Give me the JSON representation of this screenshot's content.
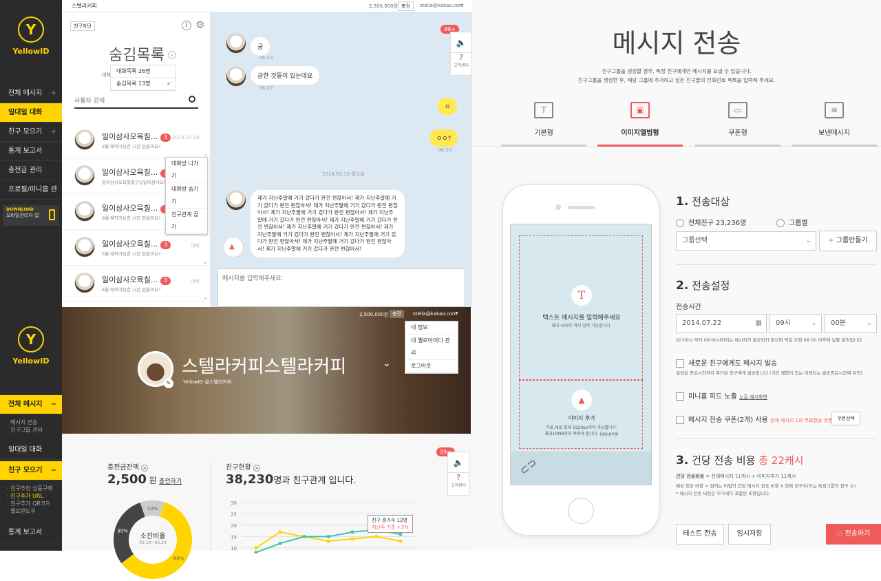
{
  "brand": {
    "logo_letter": "Y",
    "name": "YellowID"
  },
  "sidebar_top": {
    "items": [
      {
        "label": "전체 메시지",
        "plus": "+"
      },
      {
        "label": "일대일 대화"
      },
      {
        "label": "친구 모으기",
        "plus": "+"
      },
      {
        "label": "통계 보고서"
      },
      {
        "label": "충전금 관리"
      },
      {
        "label": "프로필/미니홈 관리"
      }
    ],
    "download_line1": "DOWNLOAD",
    "download_line2": "모바일관리자 앱"
  },
  "topbar": {
    "title": "스텔라커피",
    "balance": "2,500,000원",
    "charge": "충전",
    "email": "stella@kakao.com"
  },
  "hidden_list": {
    "block_label": "친구차단",
    "info_icon": "i",
    "title": "숨김목록",
    "dropdown": [
      "대화목록 26명",
      "숨김목록 13명"
    ],
    "dropdown_check": "✓",
    "truncated_line": "대화",
    "search_placeholder": "사용자 검색"
  },
  "chat_items": [
    {
      "name": "일이삼사오육칠...",
      "badge": "3",
      "preview": "6월 예약가능한 시간 있을까요?",
      "time": "2014.07.09"
    },
    {
      "name": "일이삼사오육칠...",
      "badge": "3",
      "preview": "일이삼사오육칠팔구십일이삼사오육칠"
    },
    {
      "name": "일이삼사오육칠...",
      "badge": "3",
      "preview": "6월 예약가능한 시간 있을까요?",
      "time": "어제"
    },
    {
      "name": "일이삼사오육칠...",
      "badge": "3",
      "preview": "6월 예약가능한 시간 있을까요?",
      "time": "어제"
    },
    {
      "name": "일이삼사오육칠...",
      "badge": "3",
      "preview": "6월 예약가능한 시간 있을까요?",
      "time": "어제"
    }
  ],
  "context_menu": [
    "대화방 나가기",
    "대화방 숨기기",
    "친구관계 끊기"
  ],
  "chat": {
    "msg1": "궁",
    "msg1_time": "06:20",
    "msg2": "금한 것들이 있는데요",
    "msg2_time": "06:20",
    "my1": "ㅇ",
    "my2": "ㅇㅇ?",
    "my_time": "06:20",
    "date": "2014.03.10 월요일",
    "long_msg": "제가 지난주말에 거기 갔다가 완전 편찮아서! 제가 지난주말에 거기 갔다가 완전 편찮아서! 제가 지난주말에 거기 갔다가 완전 편찮아서! 제가 지난주말에 거기 갔다가 완전 편찮아서! 제가 지난주말에 거기 갔다가 완전 편찮아서! 제가 지난주말에 거기 갔다가 완전 편찮아서! 제가 지난주말에 거기 갔다가 완전 편찮아서! 제가 지난주말에 거기 갔다가 완전 편찮아서! 제가 지난주말에 거기 갔다가 완전 편찮아서! 제가 지난주말에 거기 갔다가 완전 편찮아서! 제가 지난주말에 거기 갔다가 완전 편찮아서!",
    "input_placeholder": "메시지를 입력해주세요.",
    "unread": "99+",
    "help": "고객센터",
    "help_q": "?"
  },
  "profile": {
    "balance": "2,500,000원",
    "charge": "충전",
    "email": "stella@kakao.com",
    "menu": [
      "내 정보",
      "내 옐로아이디 관리",
      "로그아웃"
    ],
    "name": "스텔라커피스텔라커피",
    "handle": "YellowID @스텔라커피"
  },
  "sidebar_bottom": {
    "items": [
      {
        "label": "전체 메시지",
        "plus": "−"
      },
      {
        "label": "일대일 대화"
      },
      {
        "label": "친구 모으기",
        "plus": "−"
      },
      {
        "label": "통계 보고서"
      }
    ],
    "sub1": [
      "메시지 전송",
      "친구그룹 관리"
    ],
    "sub2": [
      "친구추천 상품구매",
      "친구추가 URL",
      "친구추가 QR코드",
      "옐로윈도우"
    ]
  },
  "dashboard": {
    "balance_label": "충전금잔액",
    "balance_value": "2,500",
    "balance_unit": "원",
    "charge_link": "충전하기",
    "friends_label": "친구현황",
    "friends_value": "38,230",
    "friends_suffix": "명과 친구관계 입니다.",
    "donut_center": "소진비율",
    "donut_dates": "03.19~03.24",
    "tooltip_line1": "친구 증가수 12명",
    "tooltip_line2": "지난주 기준 +3%",
    "unread": "99+",
    "help": "고객센터",
    "help_q": "?"
  },
  "send": {
    "title": "메시지 전송",
    "desc1": "친구그룹을 생성할 경우, 특정 친구에게만 메시지를 보낼 수 있습니다.",
    "desc2": "친구그룹을 생성한 후, 해당 그룹에 추가하고 싶은 친구들의 전화번호 목록을 입력해 주세요.",
    "tabs": [
      {
        "label": "기본형",
        "icon": "T"
      },
      {
        "label": "이미지앨범형",
        "icon": "▣"
      },
      {
        "label": "쿠폰형",
        "icon": "▭"
      },
      {
        "label": "보낸메시지",
        "icon": "≡"
      }
    ],
    "phone": {
      "text_icon": "T",
      "text_label": "텍스트 메시지를 입력해주세요",
      "text_limit": "최대 400자 까지 입력 가능합니다.",
      "img_label": "이미지 추가",
      "img_note1": "가로,세로 최대 1920px까지 가능합니다.",
      "img_note2": "최대10MB까지 적어야 합니다. (jpg,png)"
    },
    "s1_num": "1.",
    "s1_title": "전송대상",
    "all_friends": "전체친구 23,236명",
    "by_group": "그룹별",
    "group_select": "그룹선택",
    "make_group": "그룹만들기",
    "s2_num": "2.",
    "s2_title": "전송설정",
    "send_time": "전송시간",
    "date": "2014.07.22",
    "hour": "09시",
    "minute": "00분",
    "time_note": "20:00시 부터 08:00시까지는 메시지가 발송되지 않으며 익일 오전 08:00 이후에 일괄 발송됩니다.",
    "opt1": "새로운 친구에게도 메시지 발송",
    "opt1_note": "설정된 종료시간까지 추가된 친구에게 발송됩니다 (기간 제한이 있는 이벤트는 발송종료시간에 유의)",
    "opt2": "미니홈 피드 노출",
    "opt2_link": "노출 예시화면",
    "opt3": "메시지 전송 쿠폰(2개) 사용",
    "opt3_red": "전체 메시지 1회 무료전송 쿠폰",
    "coupon_btn": "쿠폰선택",
    "s3_num": "3.",
    "s3_title": "건당 전송 비용",
    "s3_cost": "총 22캐시",
    "cost_bold": "건당 전송비용",
    "cost_line": " = 전체메시지 11캐시 + 이미지추가 11캐시",
    "cost_note1": "예상 전송 비용 = 원하는 타입의 건당 메시지 전송 비용 X 전체 친구수(또는 특정그룹의 친구 수)",
    "cost_note2": "* 메시지 전송 비용은 부가세가 포함된 비용입니다.",
    "test_btn": "테스트 전송",
    "save_btn": "임시저장",
    "send_btn": "전송하기"
  },
  "chart_data": {
    "type": "line",
    "y_ticks": [
      "30",
      "25",
      "20",
      "15",
      "10"
    ],
    "series": [
      {
        "color": "#ffd400",
        "values": [
          10,
          17,
          15,
          13,
          14,
          15,
          13
        ]
      },
      {
        "color": "#3cc3b3",
        "values": [
          8,
          12,
          15,
          15,
          17,
          18,
          16
        ]
      }
    ],
    "ylim": [
      10,
      30
    ]
  },
  "donut": {
    "segments": [
      {
        "label": "60%",
        "value": 60,
        "color": "#ffd400"
      },
      {
        "label": "30%",
        "value": 30,
        "color": "#444"
      },
      {
        "label": "10%",
        "value": 10,
        "color": "#ccc"
      }
    ]
  }
}
